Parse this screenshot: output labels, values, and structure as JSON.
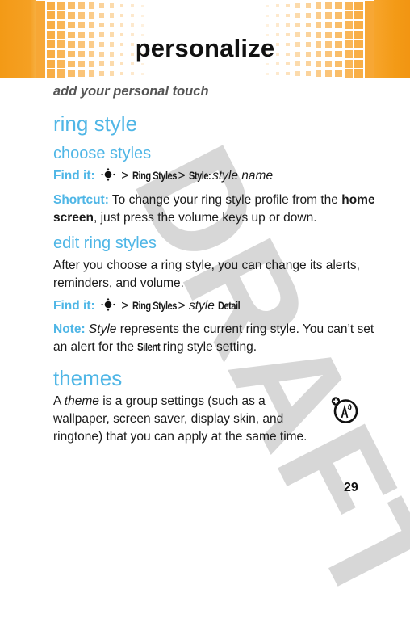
{
  "header": {
    "title": "personalize",
    "subtitle": "add your personal touch",
    "accent_color": "#f39a16"
  },
  "watermark": "DRAFT",
  "sections": {
    "ring_style": {
      "heading": "ring style",
      "choose_styles": {
        "heading": "choose styles",
        "find_it": {
          "label": "Find it:",
          "icon": "nav-key-icon",
          "sep1": ">",
          "menu1": "Ring Styles",
          "sep2": ">",
          "menu2": "Style:",
          "value": "style name"
        },
        "shortcut": {
          "label": "Shortcut:",
          "text1": " To change your ring style profile from the ",
          "bold": "home screen",
          "text2": ", just press the volume keys up or down."
        }
      },
      "edit_styles": {
        "heading": "edit ring styles",
        "body": "After you choose a ring style, you can change its alerts, reminders, and volume.",
        "find_it": {
          "label": "Find it:",
          "icon": "nav-key-icon",
          "sep1": ">",
          "menu1": "Ring Styles",
          "sep2": ">",
          "italic": "style",
          "menu2": "Detail"
        },
        "note": {
          "label": "Note:",
          "italic": "Style",
          "text1": " represents the current ring style. You can’t set an alert for the ",
          "menu": "Silent",
          "text2": " ring style setting."
        }
      }
    },
    "themes": {
      "heading": "themes",
      "text_a": "A ",
      "italic": "theme",
      "text_b": " is a group settings (such as a wallpaper, screen saver, display skin, and ringtone) that you can apply at the same time.",
      "icon": "network-feature-icon"
    }
  },
  "footer": {
    "page_number": "29"
  },
  "colors": {
    "heading": "#4fb6e6",
    "text": "#1a1a1a",
    "watermark": "#cccccc"
  }
}
